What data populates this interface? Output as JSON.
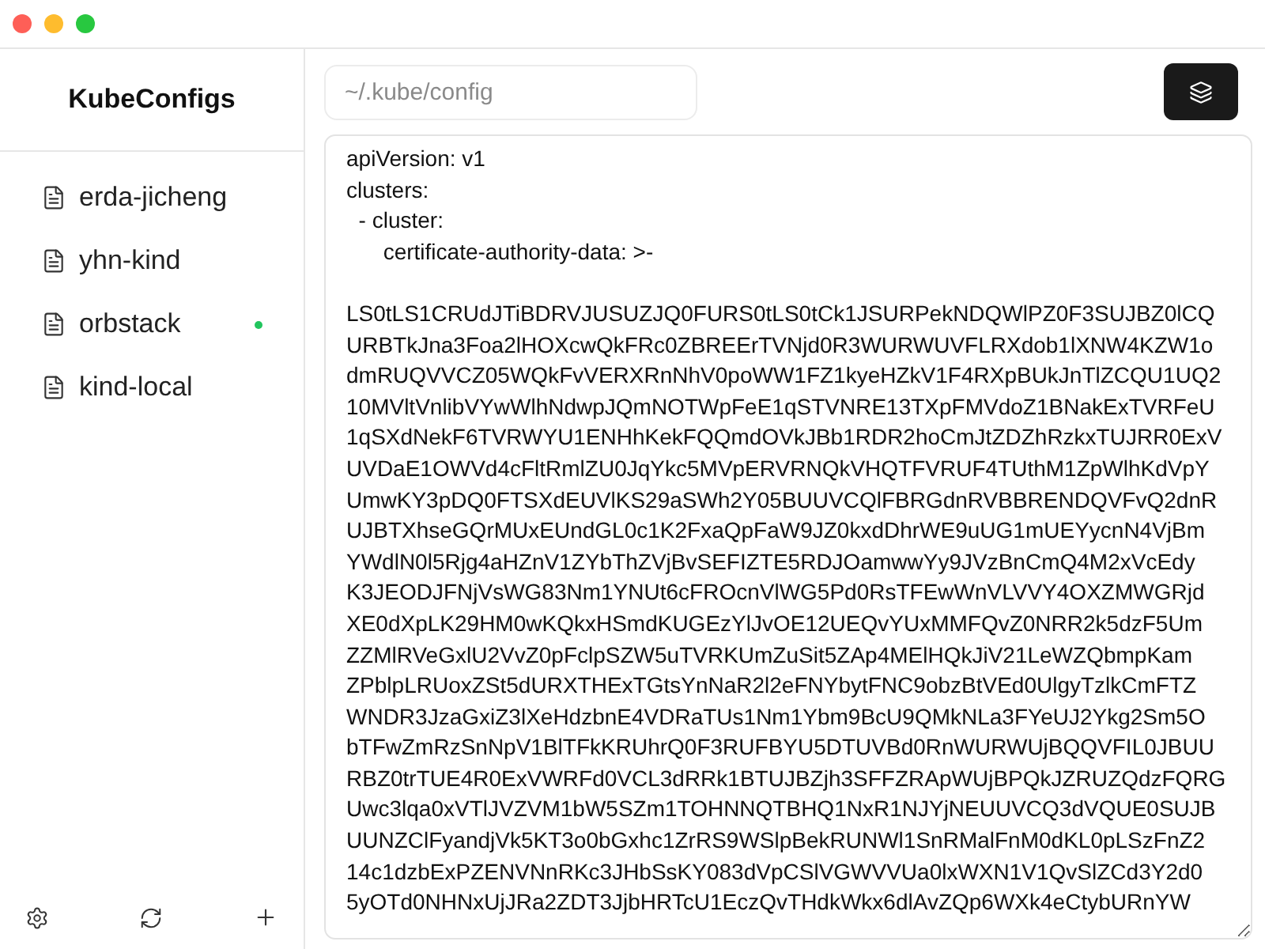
{
  "sidebar": {
    "title": "KubeConfigs",
    "items": [
      {
        "name": "erda-jicheng",
        "active": false
      },
      {
        "name": "yhn-kind",
        "active": false
      },
      {
        "name": "orbstack",
        "active": true
      },
      {
        "name": "kind-local",
        "active": false
      }
    ]
  },
  "path_field": {
    "placeholder": "~/.kube/config"
  },
  "editor": {
    "content": "apiVersion: v1\nclusters:\n  - cluster:\n      certificate-authority-data: >-\n\nLS0tLS1CRUdJTiBDRVJUSUZJQ0FURS0tLS0tCk1JSURPekNDQWlPZ0F3SUJBZ0lCQ\nURBTkJna3Foa2lHOXcwQkFRc0ZBREErTVNjd0R3WURWUVFLRXdob1lXNW4KZW1o\ndmRUQVVCZ05WQkFvVERXRnNhV0poWW1FZ1kyeHZkV1F4RXpBUkJnTlZCQU1UQ2\n10MVltVnlibVYwWlhNdwpJQmNOTWpFeE1qSTVNRE13TXpFMVdoZ1BNakExTVRFeU\n1qSXdNekF6TVRWYU1ENHhKekFQQmdOVkJBb1RDR2hoCmJtZDZhRzkxTUJRR0ExV\nUVDaE1OWVd4cFltRmlZU0JqYkc5MVpERVRNQkVHQTFVRUF4TUthM1ZpWlhKdVpY\nUmwKY3pDQ0FTSXdEUVlKS29aSWh2Y05BUUVCQlFBRGdnRVBBRENDQVFvQ2dnR\nUJBTXhseGQrMUxEUndGL0c1K2FxaQpFaW9JZ0kxdDhrWE9uUG1mUEYycnN4VjBm\nYWdlN0l5Rjg4aHZnV1ZYbThZVjBvSEFIZTE5RDJOamwwYy9JVzBnCmQ4M2xVcEdy\nK3JEODJFNjVsWG83Nm1YNUt6cFROcnVlWG5Pd0RsTFEwWnVLVVY4OXZMWGRjd\nXE0dXpLK29HM0wKQkxHSmdKUGEzYlJvOE12UEQvYUxMMFQvZ0NRR2k5dzF5Um\nZZMlRVeGxlU2VvZ0pFclpSZW5uTVRKUmZuSit5ZAp4MElHQkJiV21LeWZQbmpKam\nZPblpLRUoxZSt5dURXTHExTGtsYnNaR2l2eFNYbytFNC9obzBtVEd0UlgyTzlkCmFTZ\nWNDR3JzaGxiZ3lXeHdzbnE4VDRaTUs1Nm1Ybm9BcU9QMkNLa3FYeUJ2Ykg2Sm5O\nbTFwZmRzSnNpV1BlTFkKRUhrQ0F3RUFBYU5DTUVBd0RnWURWUjBQQVFIL0JBUU\nRBZ0trTUE4R0ExVWRFd0VCL3dRRk1BTUJBZjh3SFFZRApWUjBPQkJZRUZQdzFQRG\nUwc3lqa0xVTlJVZVM1bW5SZm1TOHNNQTBHQ1NxR1NJYjNEUUVCQ3dVQUE0SUJB\nUUNZClFyandjVk5KT3o0bGxhc1ZrRS9WSlpBekRUNWl1SnRMalFnM0dKL0pLSzFnZ2\n14c1dzbExPZENVNnRKc3JHbSsKY083dVpCSlVGWVVUa0lxWXN1V1QvSlZCd3Y2d0\n5yOTd0NHNxUjJRa2ZDT3JjbHRTcU1EczQvTHdkWkx6dlAvZQp6WXk4eCtybURnYW"
  }
}
